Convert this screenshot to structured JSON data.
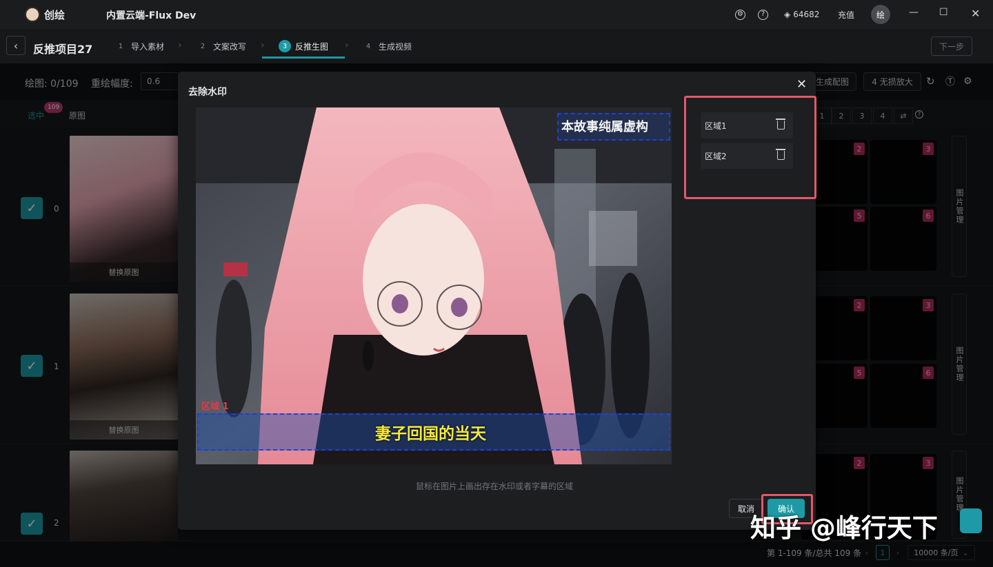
{
  "titlebar": {
    "app_name": "创绘",
    "window_title": "内置云端-Flux Dev",
    "credits": "64682",
    "recharge": "充值",
    "avatar_text": "绘"
  },
  "steps": {
    "project_name": "反推项目27",
    "items": [
      {
        "num": "1",
        "label": "导入素材"
      },
      {
        "num": "2",
        "label": "文案改写"
      },
      {
        "num": "3",
        "label": "反推生图"
      },
      {
        "num": "4",
        "label": "生成视频"
      }
    ],
    "next": "下一步"
  },
  "toolbar": {
    "draw_label": "绘图:",
    "draw_count": "0/109",
    "redraw_label": "重绘幅度:",
    "redraw_value": "0.6",
    "gen_match": "生成配图",
    "upscale": "4 无损放大"
  },
  "table": {
    "col_select": "选中",
    "select_badge": "109",
    "col_original": "原图",
    "pages": [
      "1",
      "2",
      "3",
      "4"
    ],
    "rows": [
      {
        "index": "0",
        "caption": "替换原图"
      },
      {
        "index": "1",
        "caption": "替换原图"
      },
      {
        "index": "2",
        "caption": ""
      }
    ],
    "grid_badges": [
      "2",
      "3",
      "5",
      "6"
    ],
    "image_manage": "图片管理"
  },
  "footer": {
    "summary": "第 1-109 条/总共 109 条",
    "current_page": "1",
    "page_size": "10000 条/页"
  },
  "modal": {
    "title": "去除水印",
    "overlay_caption_top": "本故事纯属虚构",
    "overlay_caption_bottom": "妻子回国的当天",
    "region_tag": "区域 1",
    "regions": [
      "区域1",
      "区域2"
    ],
    "hint": "鼠标在图片上画出存在水印或者字幕的区域",
    "cancel": "取消",
    "confirm": "确认"
  },
  "watermark": "知乎 @峰行天下",
  "colors": {
    "accent": "#1e9aa6",
    "badge": "#b02a5b",
    "highlight": "#e4586a",
    "selection": "#1f3fd8"
  }
}
